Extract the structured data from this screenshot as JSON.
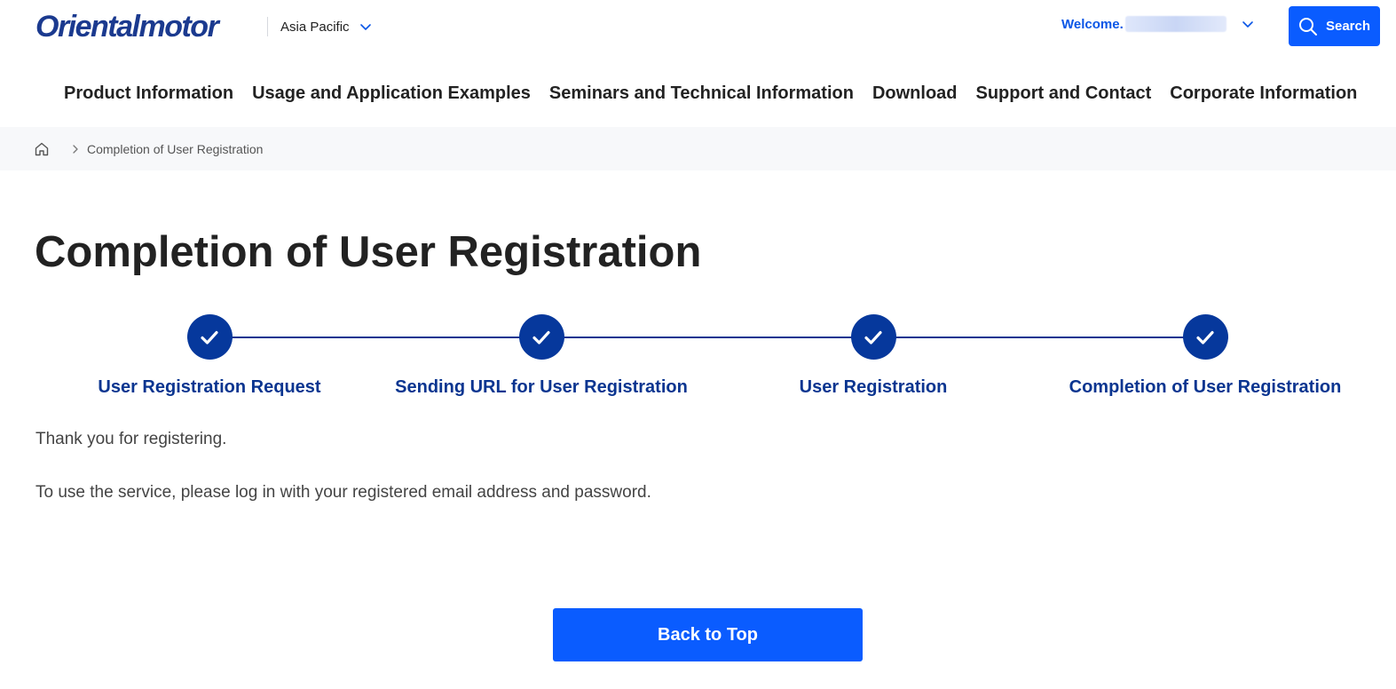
{
  "header": {
    "logo": "Orientalmotor",
    "region": "Asia Pacific",
    "welcome_label": "Welcome.",
    "search_label": "Search"
  },
  "nav": [
    {
      "label": "Product Information"
    },
    {
      "label": "Usage and Application Examples"
    },
    {
      "label": "Seminars and Technical Information"
    },
    {
      "label": "Download"
    },
    {
      "label": "Support and Contact"
    },
    {
      "label": "Corporate Information"
    }
  ],
  "breadcrumb": {
    "current": "Completion of User Registration"
  },
  "main": {
    "title": "Completion of User Registration",
    "steps": [
      {
        "label": "User Registration Request",
        "status": "completed"
      },
      {
        "label": "Sending URL for User Registration",
        "status": "completed"
      },
      {
        "label": "User Registration",
        "status": "completed"
      },
      {
        "label": "Completion of User Registration",
        "status": "completed"
      }
    ],
    "message_1": "Thank you for registering.",
    "message_2": "To use the service, please log in with your registered email address and password.",
    "back_button_label": "Back to Top"
  },
  "icons": {
    "region_chevron": "chevron-down-icon",
    "welcome_chevron": "chevron-down-icon",
    "search": "search-icon",
    "home": "home-icon",
    "breadcrumb_separator": "chevron-right-icon",
    "step_check": "check-icon"
  },
  "colors": {
    "brand_blue": "#1b3a8f",
    "primary_button": "#0a5cff",
    "step_navy": "#06389c",
    "welcome_blue": "#0a56e6",
    "breadcrumb_bg": "#f7f8fa"
  }
}
